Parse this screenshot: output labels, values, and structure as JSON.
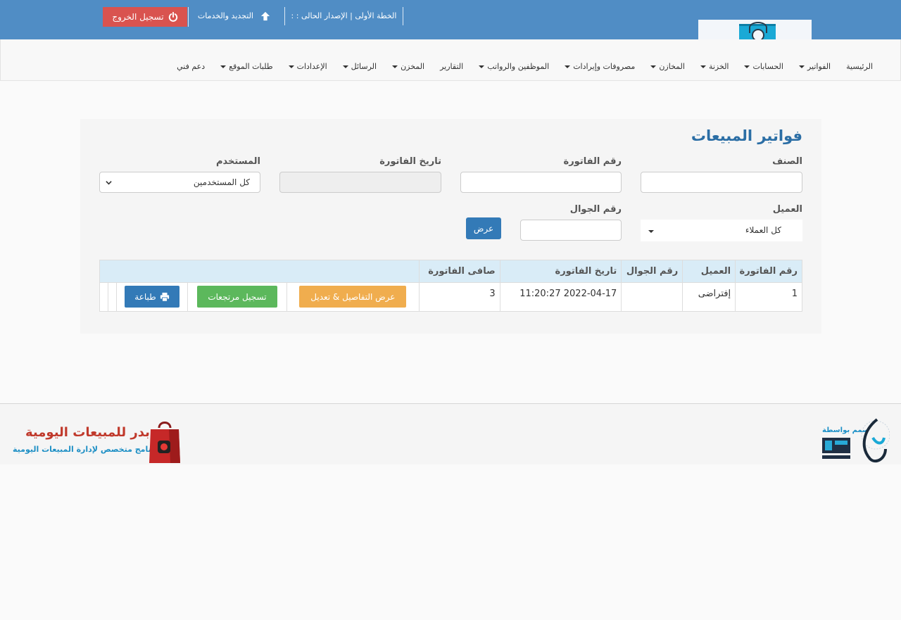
{
  "topbar": {
    "plan_text": "الخطة الأولى | الإصدار الحالى : :",
    "renew_label": "التجديد والخدمات",
    "logout_label": "تسجيل الخروج"
  },
  "nav": {
    "items": [
      {
        "label": "الرئيسية",
        "dropdown": false
      },
      {
        "label": "الفواتير",
        "dropdown": true
      },
      {
        "label": "الحسابات",
        "dropdown": true
      },
      {
        "label": "الخزنة",
        "dropdown": true
      },
      {
        "label": "المخازن",
        "dropdown": true
      },
      {
        "label": "مصروفات وإيرادات",
        "dropdown": true
      },
      {
        "label": "الموظفين والرواتب",
        "dropdown": true
      },
      {
        "label": "التقارير",
        "dropdown": false
      },
      {
        "label": "المخزن",
        "dropdown": true
      },
      {
        "label": "الرسائل",
        "dropdown": true
      },
      {
        "label": "الإعدادات",
        "dropdown": true
      },
      {
        "label": "طلبات الموقع",
        "dropdown": true
      },
      {
        "label": "دعم فني",
        "dropdown": false
      }
    ]
  },
  "panel": {
    "title": "فواتير المبيعات"
  },
  "filters": {
    "category_label": "الصنف",
    "category_value": "",
    "invoice_no_label": "رقم الفاتورة",
    "invoice_no_value": "",
    "invoice_date_label": "تاريخ الفاتورة",
    "invoice_date_value": "",
    "user_label": "المستخدم",
    "user_selected": "كل المستخدمين",
    "customer_label": "العميل",
    "customer_selected": "كل العملاء",
    "mobile_label": "رقم الجوال",
    "mobile_value": "",
    "show_button": "عرض"
  },
  "table": {
    "headers": {
      "invoice_no": "رقم الفاتورة",
      "customer": "العميل",
      "mobile": "رقم الجوال",
      "date": "تاريخ الفاتورة",
      "net": "صافى الفاتورة"
    },
    "rows": [
      {
        "invoice_no": "1",
        "customer": "إفتراضى",
        "mobile": "",
        "date": "2022-04-17 11:20:27",
        "net": "3",
        "details_button": "عرض التفاصيل & تعديل",
        "returns_button": "تسجيل مرتجعات",
        "print_button": "طباعة"
      }
    ]
  },
  "footer": {
    "product_title": "بدر للمبيعات اليومية",
    "product_tagline": "برنامج متخصص لإدارة المبيعات اليومية",
    "made_by": "صمم بواسطة"
  },
  "icons": {
    "logout": "power-icon",
    "renew": "arrow-up-icon",
    "print": "printer-icon",
    "select": "chevron-down-icon"
  },
  "colors": {
    "topbar": "#508dc5",
    "logout": "#d9534f",
    "primary": "#337ab7",
    "warning": "#f0ad4e",
    "success": "#5cb85c",
    "title": "#2b6ea5",
    "table_header": "#d9ecf7"
  }
}
